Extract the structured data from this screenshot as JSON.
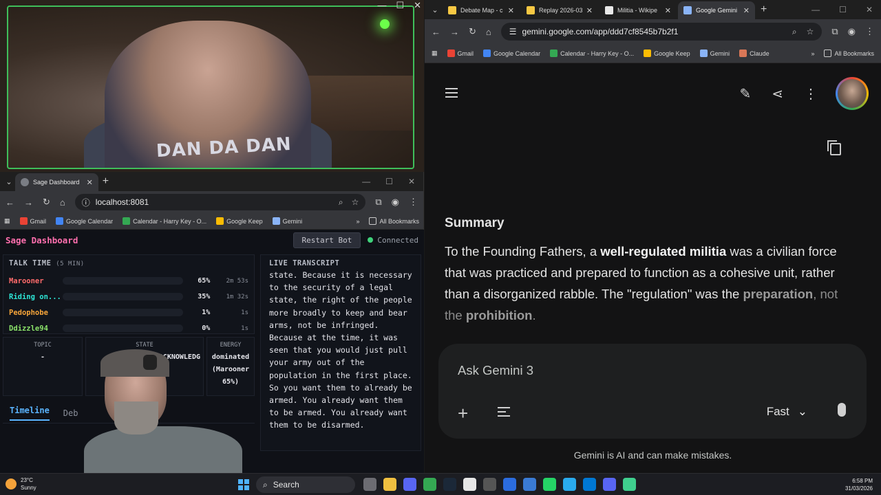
{
  "webcam": {
    "shirt_text": "DAN DA DAN",
    "controls": [
      "—",
      "☐",
      "✕"
    ]
  },
  "left_browser": {
    "tab": {
      "title": "Sage Dashboard",
      "close": "✕",
      "new": "+"
    },
    "window_controls": [
      "—",
      "☐",
      "✕"
    ],
    "nav": {
      "back": "←",
      "forward": "→",
      "reload": "↻",
      "home": "⌂"
    },
    "address": "localhost:8081",
    "bookmarks": [
      {
        "label": "Gmail",
        "color": "#ea4335"
      },
      {
        "label": "Google Calendar",
        "color": "#4285f4"
      },
      {
        "label": "Calendar - Harry Key - O...",
        "color": "#34a853"
      },
      {
        "label": "Google Keep",
        "color": "#fbbc04"
      },
      {
        "label": "Gemini",
        "color": "#8ab4f8"
      }
    ],
    "bookmarks_more": "»",
    "all_bookmarks": "All Bookmarks"
  },
  "sage": {
    "title": "Sage Dashboard",
    "restart_label": "Restart Bot",
    "status": "Connected",
    "talk_time_label": "TALK TIME",
    "talk_time_window": "(5 MIN)",
    "speakers": [
      {
        "name": "Marooner",
        "color": "#ff6b6b",
        "bar_color": "#e99aa6",
        "fraction": 0.65,
        "pct": "65%",
        "duration": "2m 53s"
      },
      {
        "name": "Riding on...",
        "color": "#2ee6d6",
        "bar_color": "#2ee6d6",
        "fraction": 0.35,
        "pct": "35%",
        "duration": "1m 32s"
      },
      {
        "name": "Pedophobe",
        "color": "#f7a53a",
        "bar_color": "#f7a53a",
        "fraction": 0.01,
        "pct": "1%",
        "duration": "1s"
      },
      {
        "name": "Ddizzle94",
        "color": "#8be36a",
        "bar_color": "#8be36a",
        "fraction": 0.0,
        "pct": "0%",
        "duration": "1s"
      }
    ],
    "cards": {
      "topic_label": "TOPIC",
      "topic_value": "-",
      "state_label": "STATE",
      "state_value": "ACKNOWLEDG",
      "energy_label": "ENERGY",
      "energy_value": "dominated (Marooner 65%)"
    },
    "tabs": {
      "timeline": "Timeline",
      "debug": "Deb"
    },
    "transcript_label": "LIVE TRANSCRIPT",
    "transcript": "state. Because it is necessary to the security of a legal state, the right of the people more broadly to keep and bear arms, not be infringed. Because at the time, it was seen that you would just pull your army out of the population in the first place. So you want them to already be armed. You already want them to be armed. You already want them to be disarmed."
  },
  "right_browser": {
    "tabs": [
      {
        "title": "Debate Map - c",
        "color": "#f7c843",
        "active": false
      },
      {
        "title": "Replay 2026-03",
        "color": "#f7c843",
        "active": false
      },
      {
        "title": "Militia - Wikipe",
        "color": "#e8e8e8",
        "active": false
      },
      {
        "title": "Google Gemini",
        "color": "#8ab4f8",
        "active": true
      }
    ],
    "tab_close": "✕",
    "new_tab": "+",
    "window_controls": [
      "—",
      "☐",
      "✕"
    ],
    "nav": {
      "back": "←",
      "forward": "→",
      "reload": "↻",
      "home": "⌂"
    },
    "address": "gemini.google.com/app/ddd7cf8545b7b2f1",
    "bookmarks": [
      {
        "label": "Gmail",
        "color": "#ea4335"
      },
      {
        "label": "Google Calendar",
        "color": "#4285f4"
      },
      {
        "label": "Calendar - Harry Key - O...",
        "color": "#34a853"
      },
      {
        "label": "Google Keep",
        "color": "#fbbc04"
      },
      {
        "label": "Gemini",
        "color": "#8ab4f8"
      },
      {
        "label": "Claude",
        "color": "#d97757"
      }
    ],
    "bookmarks_more": "»",
    "all_bookmarks": "All Bookmarks"
  },
  "gemini": {
    "summary_heading": "Summary",
    "summary_p1": "To the Founding Fathers, a ",
    "summary_bold1": "well-regulated militia",
    "summary_p2": " was a civilian force that was practiced and prepared to function as a cohesive unit, rather than a disorganized rabble. The \"regulation\" was the ",
    "summary_bold2": "preparation",
    "summary_p3": ", not the ",
    "summary_bold3": "prohibition",
    "summary_p4": ".",
    "prompt_placeholder": "Ask Gemini 3",
    "plus": "+",
    "mode_label": "Fast",
    "mode_chevron": "⌄",
    "disclaimer": "Gemini is AI and can make mistakes."
  },
  "taskbar": {
    "weather_temp": "23°C",
    "weather_desc": "Sunny",
    "search_label": "Search",
    "time": "6:58 PM",
    "date": "31/03/2026",
    "app_colors": [
      "#6c6c72",
      "#f0c040",
      "#5865f2",
      "#34a853",
      "#1b2838",
      "#e6e6e6",
      "#555",
      "#2b6cde",
      "#3a7bd5",
      "#25d366",
      "#2aabee",
      "#0078d4",
      "#5865f2",
      "#3fcf8e"
    ]
  }
}
